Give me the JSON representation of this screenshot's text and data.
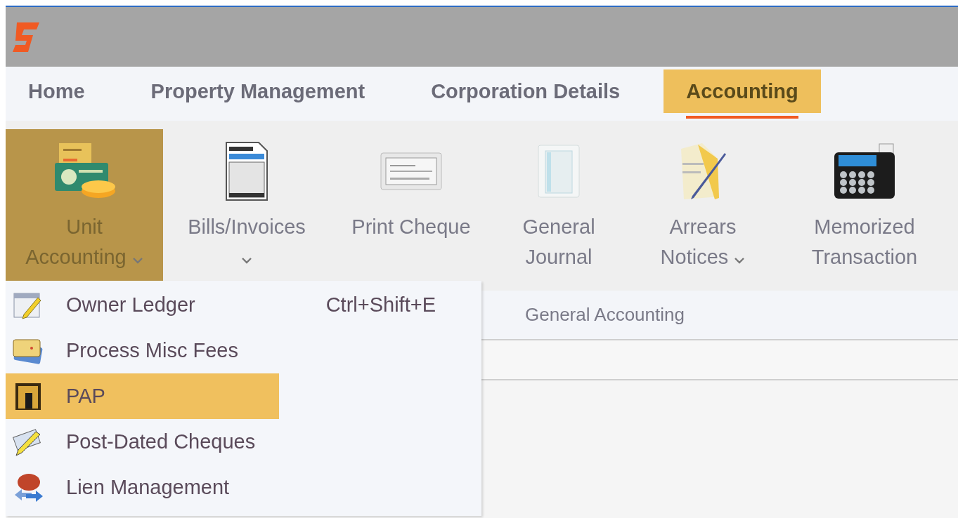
{
  "tabs": [
    {
      "label": "Home",
      "selected": false
    },
    {
      "label": "Property Management",
      "selected": false
    },
    {
      "label": "Corporation Details",
      "selected": false
    },
    {
      "label": "Accounting",
      "selected": true
    }
  ],
  "ribbon": {
    "items": [
      {
        "label": "Unit Accounting",
        "kind": "cash",
        "dropdown": true,
        "selected": true
      },
      {
        "label": "Bills/Invoices",
        "kind": "invoice",
        "dropdown": true,
        "selected": false
      },
      {
        "label": "Print Cheque",
        "kind": "cheque",
        "dropdown": false,
        "selected": false
      },
      {
        "label": "General Journal",
        "kind": "journal",
        "dropdown": false,
        "selected": false
      },
      {
        "label": "Arrears Notices",
        "kind": "notice",
        "dropdown": true,
        "selected": false
      },
      {
        "label": "Memorized Transaction",
        "kind": "calculator",
        "dropdown": false,
        "selected": false
      }
    ],
    "group_label": "General Accounting"
  },
  "menu": {
    "items": [
      {
        "label": "Owner Ledger",
        "kind": "ledger",
        "shortcut": "Ctrl+Shift+E",
        "selected": false
      },
      {
        "label": "Process Misc Fees",
        "kind": "fees",
        "selected": false
      },
      {
        "label": "PAP",
        "kind": "door",
        "selected": true
      },
      {
        "label": "Post-Dated Cheques",
        "kind": "pencil",
        "selected": false
      },
      {
        "label": "Lien Management",
        "kind": "lien",
        "selected": false
      }
    ]
  }
}
